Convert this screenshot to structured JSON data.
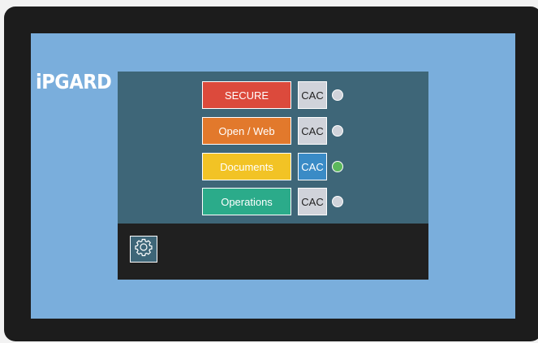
{
  "brand": {
    "logo_text": "iPGARD"
  },
  "channels": [
    {
      "label": "SECURE",
      "color": "#dc4a3c",
      "cac_label": "CAC",
      "cac_active": false,
      "status": "idle"
    },
    {
      "label": "Open / Web",
      "color": "#e2792c",
      "cac_label": "CAC",
      "cac_active": false,
      "status": "idle"
    },
    {
      "label": "Documents",
      "color": "#f2c325",
      "cac_label": "CAC",
      "cac_active": true,
      "status": "active"
    },
    {
      "label": "Operations",
      "color": "#2bab8a",
      "cac_label": "CAC",
      "cac_active": false,
      "status": "idle"
    }
  ],
  "colors": {
    "cac_inactive": "#d0d3da",
    "cac_active": "#3a8bc6",
    "led_idle": "#d0d3da",
    "led_active": "#5cb85c"
  },
  "footer": {
    "settings_icon": "gear-icon"
  }
}
